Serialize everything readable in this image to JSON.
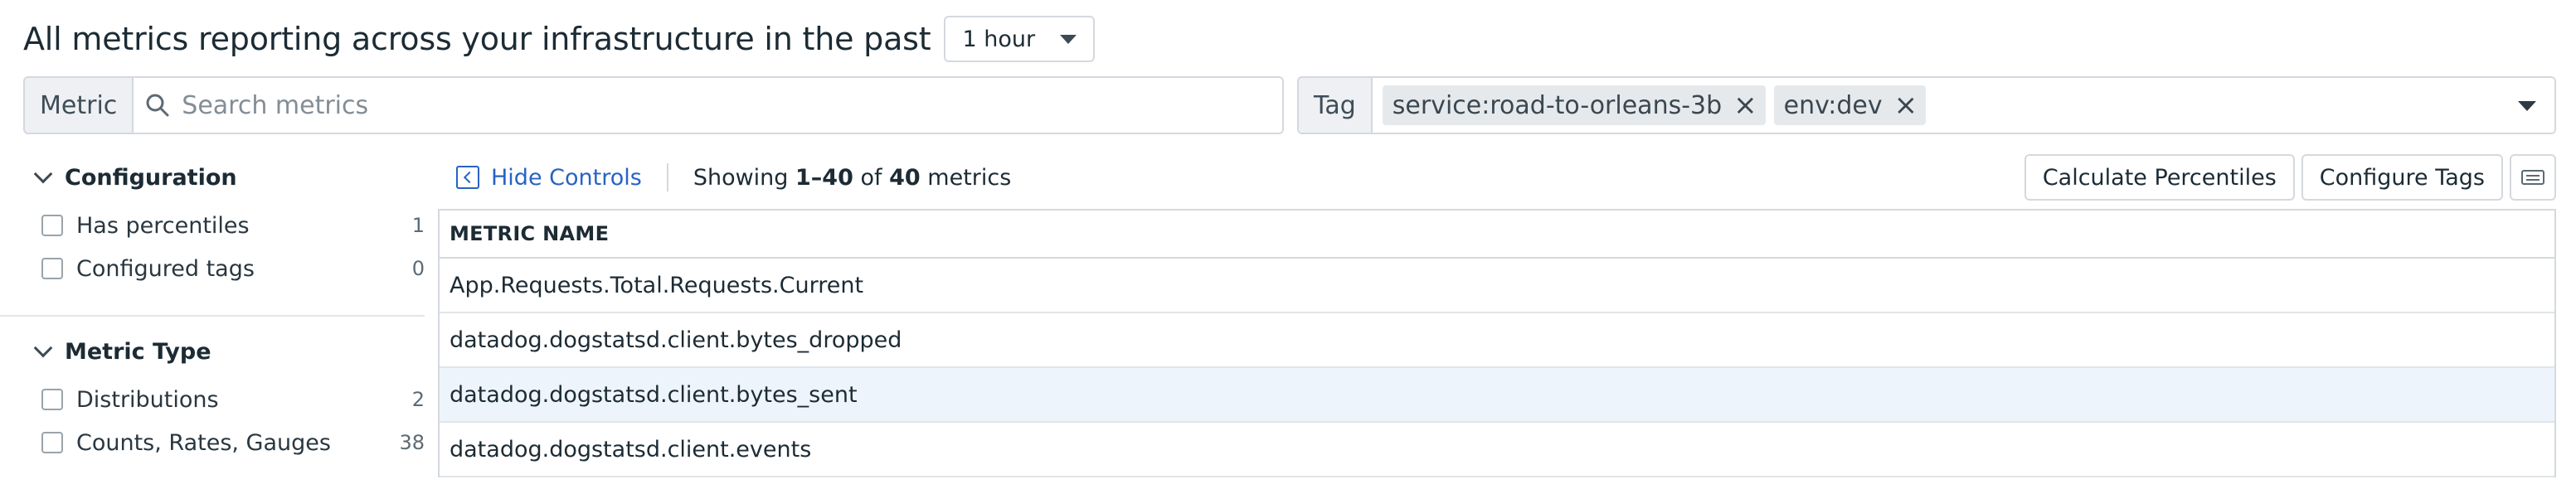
{
  "header": {
    "title": "All metrics reporting across your infrastructure in the past",
    "time_range": "1 hour"
  },
  "metric_filter": {
    "label": "Metric",
    "placeholder": "Search metrics",
    "value": ""
  },
  "tag_filter": {
    "label": "Tag",
    "chips": [
      "service:road-to-orleans-3b",
      "env:dev"
    ]
  },
  "sidebar": {
    "sections": [
      {
        "title": "Configuration",
        "facets": [
          {
            "label": "Has percentiles",
            "count": "1"
          },
          {
            "label": "Configured tags",
            "count": "0"
          }
        ]
      },
      {
        "title": "Metric Type",
        "facets": [
          {
            "label": "Distributions",
            "count": "2"
          },
          {
            "label": "Counts, Rates, Gauges",
            "count": "38"
          }
        ]
      }
    ]
  },
  "toolbar": {
    "hide_controls": "Hide Controls",
    "showing_prefix": "Showing",
    "range": "1–40",
    "of": "of",
    "total": "40",
    "suffix": "metrics",
    "calc_percentiles": "Calculate Percentiles",
    "configure_tags": "Configure Tags"
  },
  "table": {
    "header": "METRIC NAME",
    "rows": [
      "App.Requests.Total.Requests.Current",
      "datadog.dogstatsd.client.bytes_dropped",
      "datadog.dogstatsd.client.bytes_sent",
      "datadog.dogstatsd.client.events"
    ],
    "highlighted_row": 2
  },
  "colors": {
    "link": "#2763c4",
    "row_highlight": "#eef4fb",
    "border": "#d4d9de"
  }
}
